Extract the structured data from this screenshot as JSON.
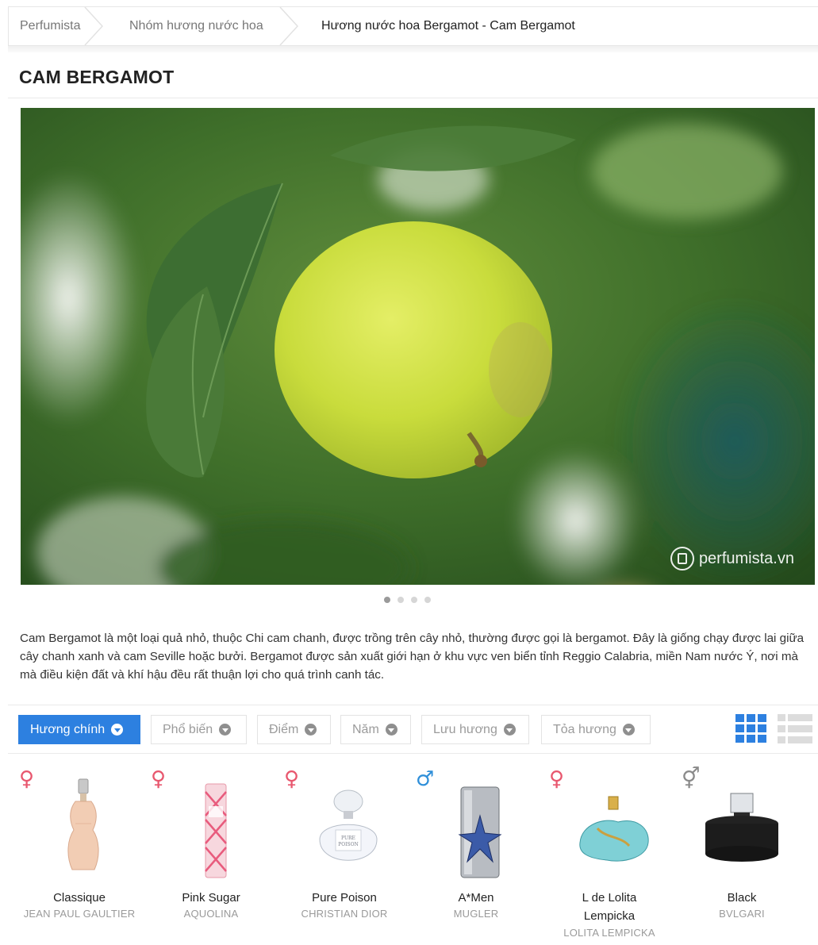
{
  "breadcrumb": {
    "items": [
      "Perfumista",
      "Nhóm hương nước hoa"
    ],
    "current": "Hương nước hoa Bergamot - Cam Bergamot"
  },
  "page_title": "CAM BERGAMOT",
  "hero": {
    "watermark": "perfumista.vn",
    "slide_count": 4,
    "active_slide": 1
  },
  "description": "Cam Bergamot là một loại quả nhỏ, thuộc Chi cam chanh, được trồng trên cây nhỏ, thường được gọi là bergamot. Đây là giống chạy được lai giữa cây chanh xanh và cam Seville hoặc bưởi. Bergamot được sản xuất giới hạn ở khu vực ven biển tỉnh Reggio Calabria, miền Nam nước Ý, nơi mà mà điều kiện đất và khí hậu đều rất thuận lợi cho quá trình canh tác.",
  "filters": [
    {
      "label": "Hương chính",
      "active": true
    },
    {
      "label": "Phổ biến",
      "active": false
    },
    {
      "label": "Điểm",
      "active": false
    },
    {
      "label": "Năm",
      "active": false
    },
    {
      "label": "Lưu hương",
      "active": false
    },
    {
      "label": "Tỏa hương",
      "active": false
    }
  ],
  "colors": {
    "accent": "#2d80e0",
    "female": "#e8576e",
    "male": "#2f8fd9",
    "unisex": "#8a8a8a"
  },
  "products": [
    {
      "name": "Classique",
      "brand": "JEAN PAUL GAULTIER",
      "gender": "female",
      "gender_symbol": "♀"
    },
    {
      "name": "Pink Sugar",
      "brand": "AQUOLINA",
      "gender": "female",
      "gender_symbol": "♀"
    },
    {
      "name": "Pure Poison",
      "brand": "CHRISTIAN DIOR",
      "gender": "female",
      "gender_symbol": "♀"
    },
    {
      "name": "A*Men",
      "brand": "MUGLER",
      "gender": "male",
      "gender_symbol": "♂"
    },
    {
      "name": "L de Lolita Lempicka",
      "brand": "LOLITA LEMPICKA",
      "gender": "female",
      "gender_symbol": "♀"
    },
    {
      "name": "Black",
      "brand": "BVLGARI",
      "gender": "unisex",
      "gender_symbol": "⚥"
    }
  ]
}
